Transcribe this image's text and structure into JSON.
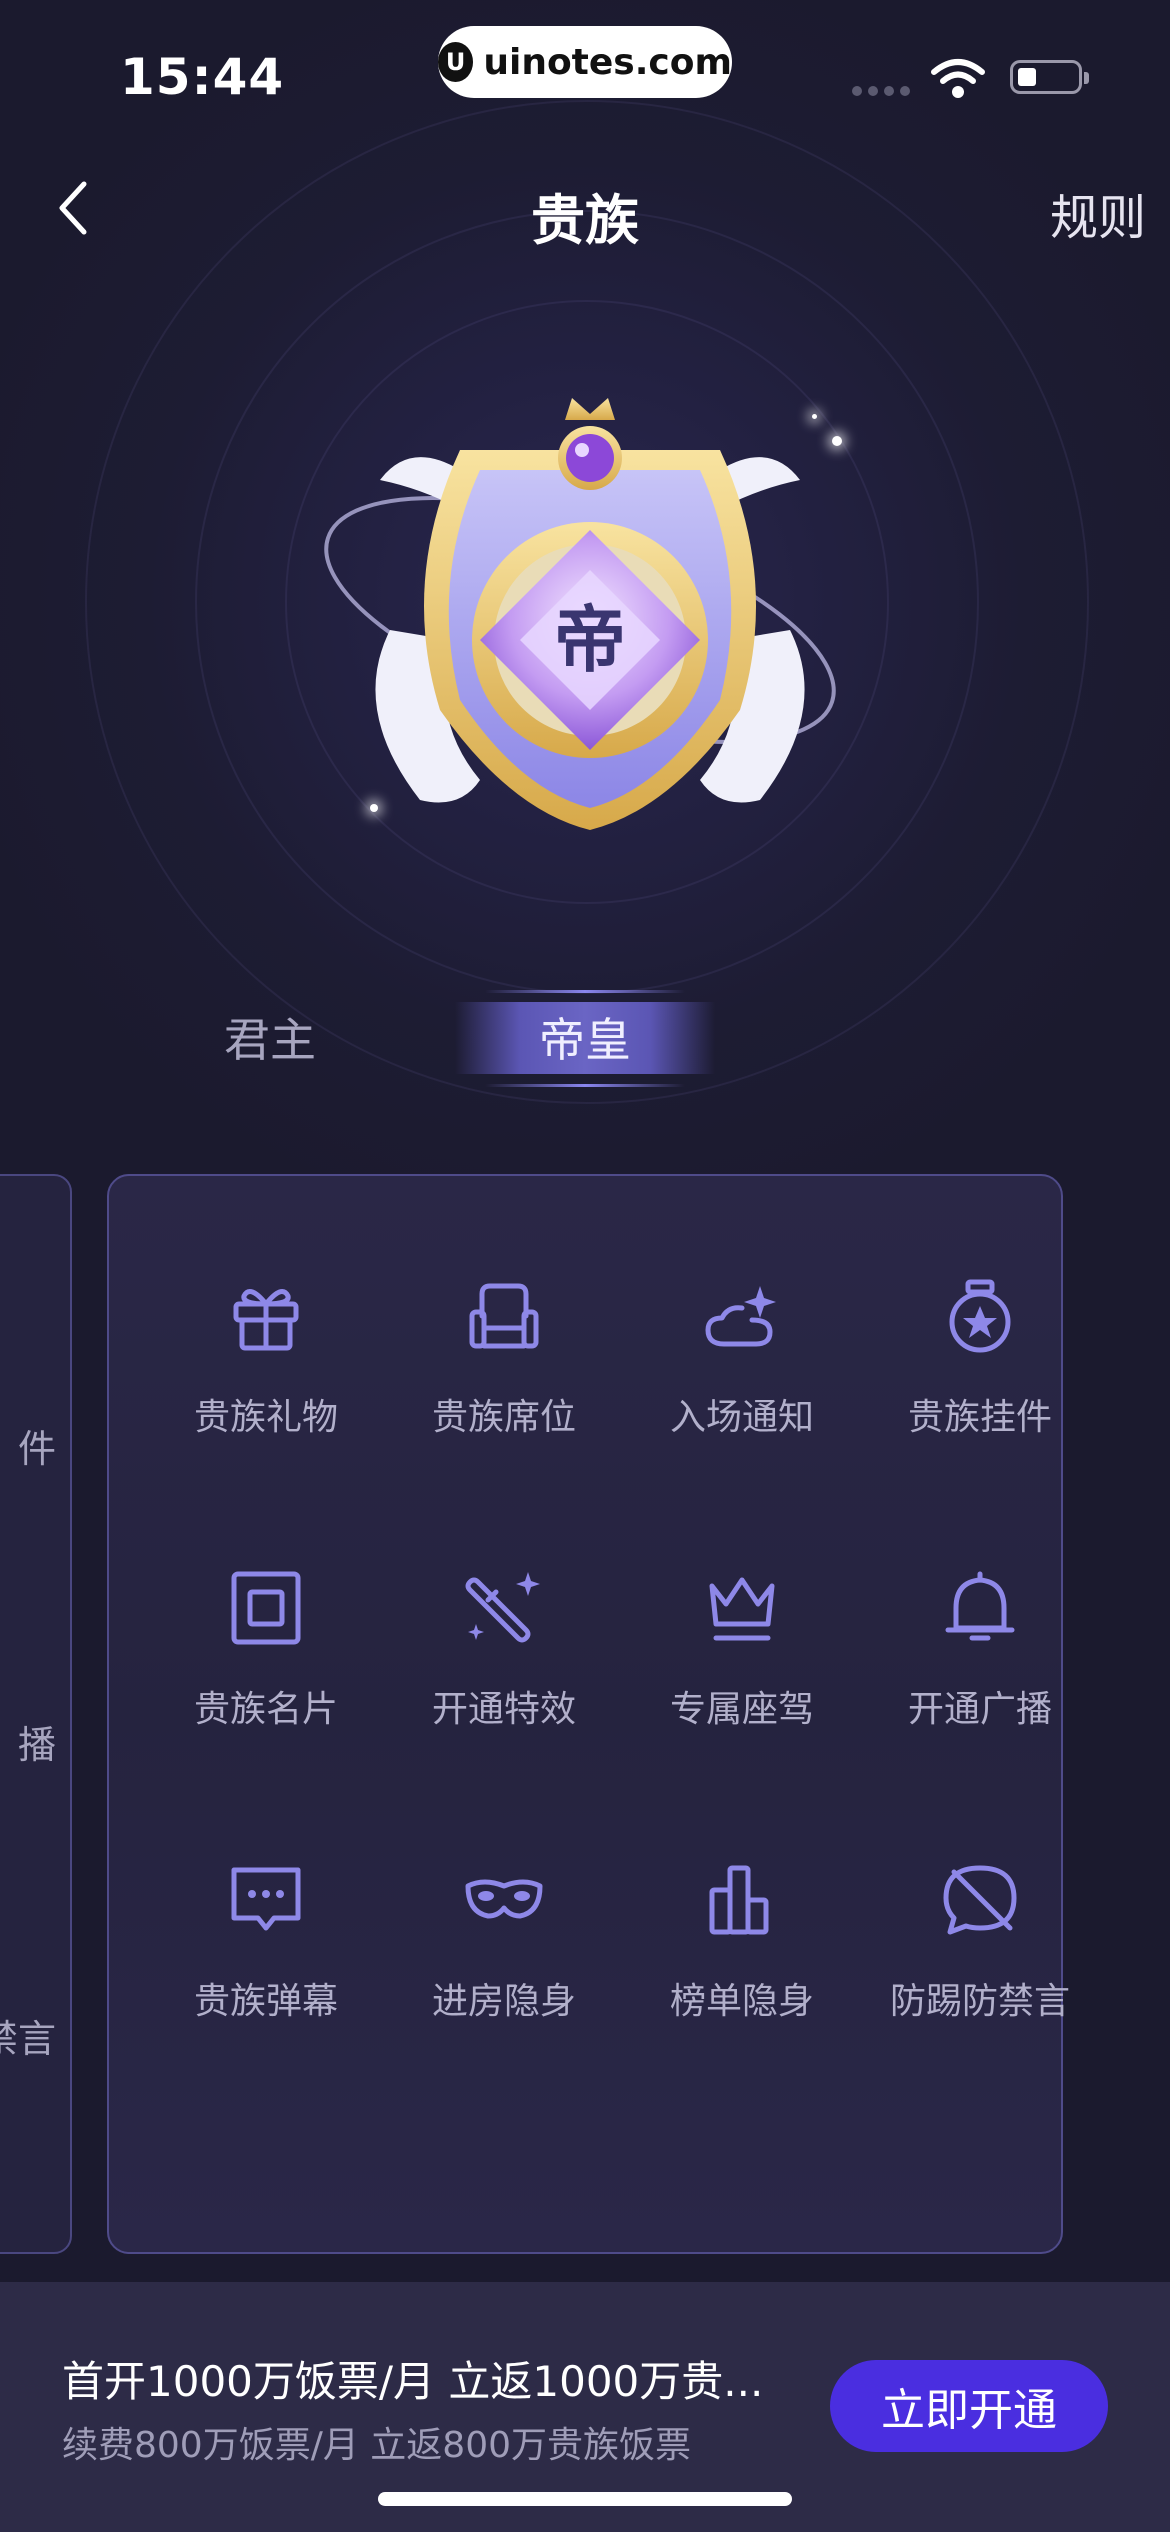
{
  "status_bar": {
    "time": "15:44",
    "site": "uinotes.com",
    "site_logo": "U"
  },
  "header": {
    "title": "贵族",
    "rules": "规则"
  },
  "badge": {
    "emblem_char": "帝"
  },
  "tabs": [
    {
      "label": "君主",
      "active": false
    },
    {
      "label": "帝皇",
      "active": true
    }
  ],
  "prev_card_fragments": [
    "件",
    "播",
    "禁言"
  ],
  "perks": [
    {
      "label": "贵族礼物",
      "icon": "gift-icon"
    },
    {
      "label": "贵族席位",
      "icon": "seat-icon"
    },
    {
      "label": "入场通知",
      "icon": "cloud-sparkle-icon"
    },
    {
      "label": "贵族挂件",
      "icon": "medal-icon"
    },
    {
      "label": "贵族名片",
      "icon": "card-icon"
    },
    {
      "label": "开通特效",
      "icon": "magic-wand-icon"
    },
    {
      "label": "专属座驾",
      "icon": "crown-icon"
    },
    {
      "label": "开通广播",
      "icon": "bell-icon"
    },
    {
      "label": "贵族弹幕",
      "icon": "chat-bubble-icon"
    },
    {
      "label": "进房隐身",
      "icon": "mask-icon"
    },
    {
      "label": "榜单隐身",
      "icon": "bar-chart-icon"
    },
    {
      "label": "防踢防禁言",
      "icon": "no-chat-icon"
    }
  ],
  "bottom": {
    "offer_main": "首开1000万饭票/月 立返1000万贵...",
    "offer_sub": "续费800万饭票/月 立返800万贵族饭票",
    "button": "立即开通"
  },
  "colors": {
    "background": "#1b1a2e",
    "accent": "#4a2ee0",
    "icon": "#8e88e8"
  }
}
